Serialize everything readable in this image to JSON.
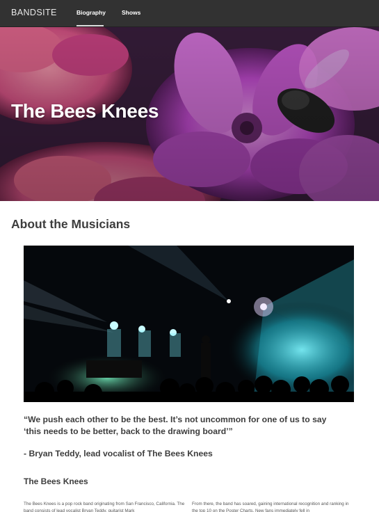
{
  "nav": {
    "brand": "BANDSITE",
    "links": [
      "Biography",
      "Shows"
    ],
    "active": "Biography"
  },
  "hero": {
    "title": "The Bees Knees"
  },
  "about": {
    "heading": "About the Musicians",
    "quote": "“We push each other to be the best. It’s not uncommon for one of us to say ‘this needs to be better, back to the drawing board’”",
    "attribution": "- Bryan Teddy, lead vocalist of The Bees Knees"
  },
  "band": {
    "heading": "The Bees Knees",
    "paragraph_left": "The Bees Knees is a pop rock band originating from San Francisco, California. The band consists of lead vocalist Bryan Teddy, guitarist Mark",
    "paragraph_right": "From there, the band has soared, gaining international recognition and ranking in the top 10 on the Poster Charts. New fans immediately fell in"
  },
  "colors": {
    "navbar": "#323232",
    "accent_underline": "#dcdcdc",
    "text": "#3d3d3d"
  }
}
